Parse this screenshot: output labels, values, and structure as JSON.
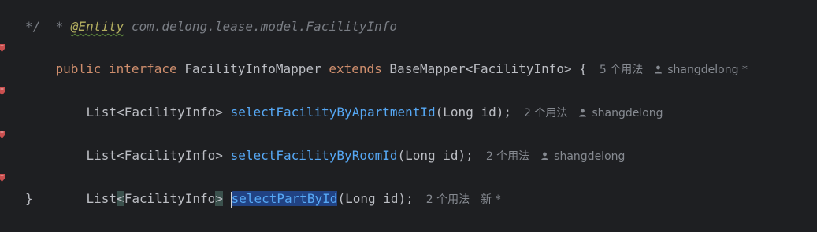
{
  "editor": {
    "lines": {
      "comment_entity": {
        "star": "* ",
        "annotation": "@Entity",
        "rest": " com.delong.lease.model.FacilityInfo"
      },
      "comment_end": "*/",
      "interface_decl": {
        "kw_public": "public",
        "kw_interface": "interface",
        "name": "FacilityInfoMapper",
        "kw_extends": "extends",
        "base": "BaseMapper<FacilityInfo> {",
        "usages": "5 个用法",
        "author": "shangdelong *"
      },
      "method1": {
        "return_type": "List<FacilityInfo>",
        "name": "selectFacilityByApartmentId",
        "params": "(Long id);",
        "usages": "2 个用法",
        "author": "shangdelong"
      },
      "method2": {
        "return_type": "List<FacilityInfo>",
        "name": "selectFacilityByRoomId",
        "params": "(Long id);",
        "usages": "2 个用法",
        "author": "shangdelong"
      },
      "method3": {
        "list": "List",
        "lt": "<",
        "type": "FacilityInfo",
        "gt": ">",
        "name": "selectPartById",
        "params": "(Long id);",
        "usages": "2 个用法",
        "author": "新 *"
      },
      "closing": "}"
    },
    "icons": {
      "gutter": "mapper-navigation-icon",
      "author": "user-icon"
    },
    "colors": {
      "background": "#1e1f22",
      "keyword": "#cf8e6d",
      "method": "#56a8f5",
      "comment": "#7a7e85",
      "text": "#bcbec4",
      "hint": "#868a91"
    }
  }
}
